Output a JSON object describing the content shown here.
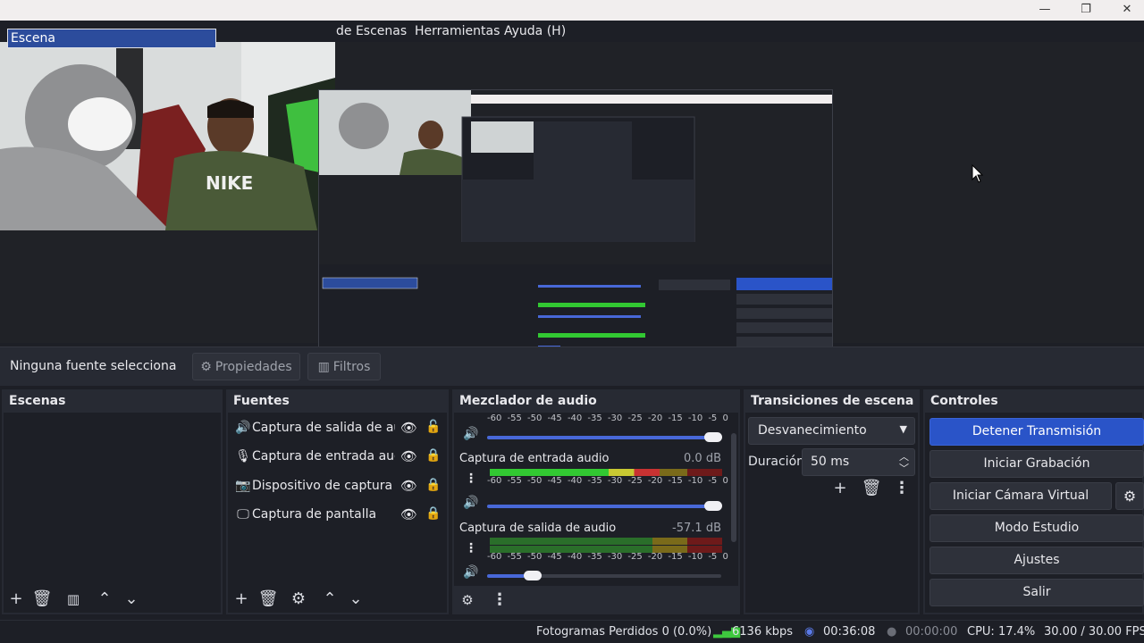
{
  "menu": [
    "de Escenas",
    "Herramientas",
    "Ayuda (H)"
  ],
  "window_controls": {
    "minimize": "—",
    "maximize": "❐",
    "close": "✕"
  },
  "source_bar": {
    "no_selection": "Ninguna fuente selecciona",
    "properties": "Propiedades",
    "filters": "Filtros"
  },
  "scenes": {
    "title": "Escenas",
    "items": [
      "Escena"
    ]
  },
  "sources": {
    "title": "Fuentes",
    "items": [
      {
        "icon": "speaker-icon",
        "label": "Captura de salida de audic"
      },
      {
        "icon": "microphone-icon",
        "label": "Captura de entrada audio"
      },
      {
        "icon": "camera-icon",
        "label": "Dispositivo de captura de v"
      },
      {
        "icon": "monitor-icon",
        "label": "Captura de pantalla"
      }
    ]
  },
  "mixer": {
    "title": "Mezclador de audio",
    "scale": [
      "-60",
      "-55",
      "-50",
      "-45",
      "-40",
      "-35",
      "-30",
      "-25",
      "-20",
      "-15",
      "-10",
      "-5",
      "0"
    ],
    "channels": [
      {
        "label": "",
        "db": "",
        "level": 0,
        "volume": 0.97
      },
      {
        "label": "Captura de entrada audio",
        "db": "0.0 dB",
        "level": 0.72,
        "volume": 0.97
      },
      {
        "label": "Captura de salida de audio",
        "db": "-57.1 dB",
        "level": 0.85,
        "volume": 0.2
      }
    ]
  },
  "transitions": {
    "title": "Transiciones de escena",
    "type": "Desvanecimiento",
    "duration_label": "Duración",
    "duration_value": "50 ms"
  },
  "controls": {
    "title": "Controles",
    "stop_streaming": "Detener Transmisión",
    "start_recording": "Iniciar Grabación",
    "start_virtual_cam": "Iniciar Cámara Virtual",
    "studio_mode": "Modo Estudio",
    "settings": "Ajustes",
    "exit": "Salir"
  },
  "status": {
    "dropped_frames": "Fotogramas Perdidos 0 (0.0%)",
    "bitrate": "6136 kbps",
    "stream_time": "00:36:08",
    "record_time": "00:00:00",
    "cpu": "CPU: 17.4%",
    "fps": "30.00 / 30.00 FPS"
  },
  "colors": {
    "accent": "#2a54c8",
    "background": "#1d1f26",
    "dock": "#272a33"
  }
}
